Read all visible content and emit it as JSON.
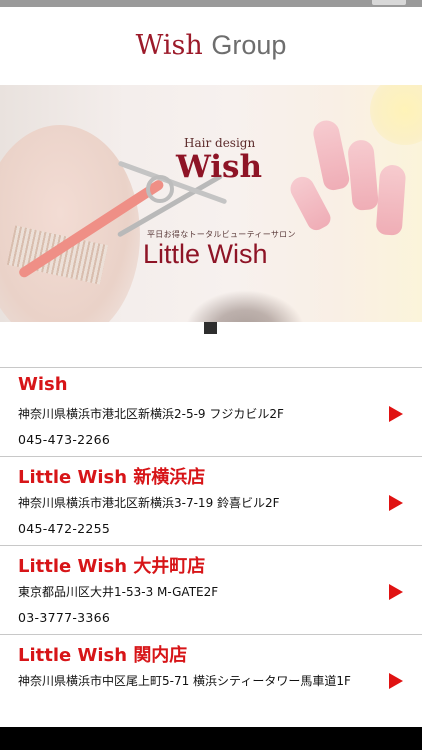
{
  "header": {
    "logo_wish": "Wish",
    "logo_group": "Group"
  },
  "hero": {
    "hair_design": "Hair design",
    "wish": "Wish",
    "subtitle": "平日お得なトータルビューティーサロン",
    "little_wish": "Little Wish"
  },
  "carousel": {
    "current": 1,
    "total": 1
  },
  "salons": [
    {
      "name": "Wish",
      "address": "神奈川県横浜市港北区新横浜2-5-9 フジカビル2F",
      "phone": "045-473-2266"
    },
    {
      "name": "Little Wish 新横浜店",
      "address": "神奈川県横浜市港北区新横浜3-7-19 鈴喜ビル2F",
      "phone": "045-472-2255"
    },
    {
      "name": "Little Wish 大井町店",
      "address": "東京都品川区大井1-53-3 M-GATE2F",
      "phone": "03-3777-3366"
    },
    {
      "name": "Little Wish 関内店",
      "address": "神奈川県横浜市中区尾上町5-71 横浜シティータワー馬車道1F",
      "phone": ""
    }
  ],
  "colors": {
    "brand": "#8e1426",
    "accent": "#d71518",
    "arrow": "#e01212"
  },
  "icons": {
    "detail": "play-arrow-icon",
    "slide_indicator": "carousel-dot-icon"
  }
}
